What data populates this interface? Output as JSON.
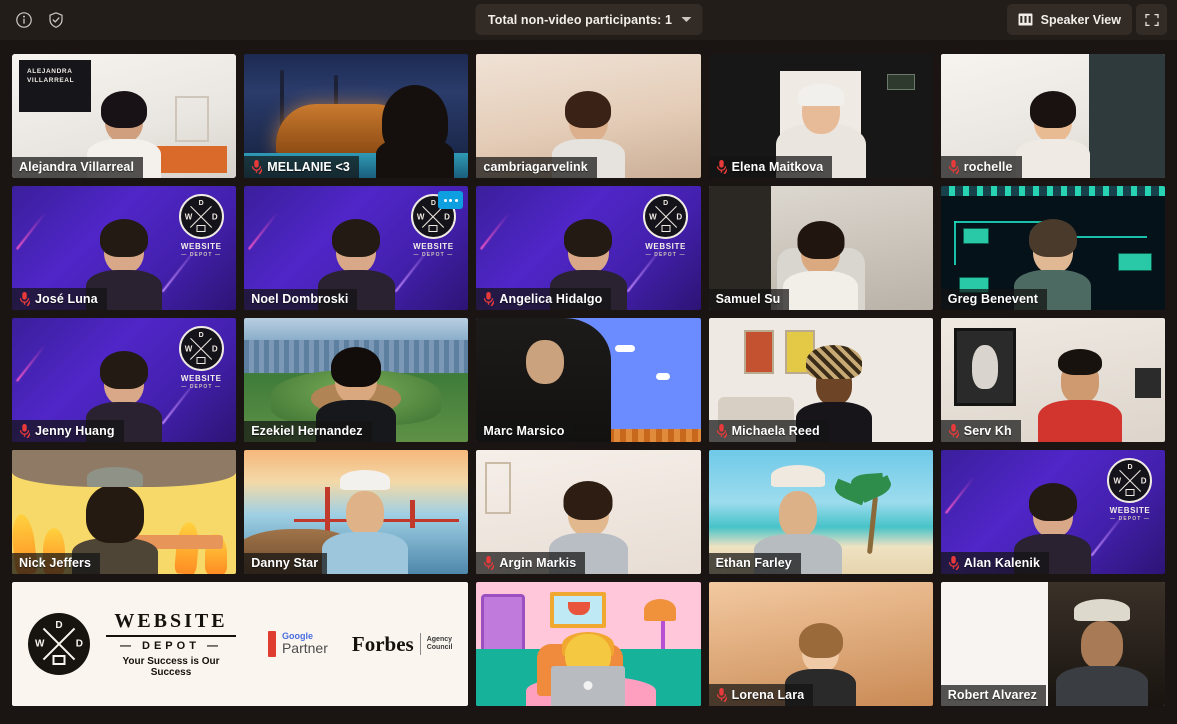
{
  "topbar": {
    "info_icon": "info-icon",
    "shield_icon": "shield-check-icon",
    "nonvideo_label": "Total non-video participants: 1",
    "speaker_view_label": "Speaker View",
    "grid_icon": "grid-view-icon",
    "fullscreen_icon": "fullscreen-icon"
  },
  "meeting": {
    "view_mode": "Gallery View",
    "accent_active_border": "#f5f0a0",
    "muted_icon_color": "#e83a3a",
    "more_button_color": "#0e9fe0",
    "nameplate_bg": "rgba(20,20,20,0.72)"
  },
  "participants": [
    {
      "name": "Alejandra Villarreal",
      "muted": false,
      "active_speaker": true,
      "more": false,
      "scene": "villarreal"
    },
    {
      "name": "MELLANIE <3",
      "muted": true,
      "active_speaker": false,
      "more": false,
      "scene": "pool"
    },
    {
      "name": "cambriagarvelink",
      "muted": false,
      "active_speaker": false,
      "more": false,
      "scene": "warm-room"
    },
    {
      "name": "Elena Maitkova",
      "muted": true,
      "active_speaker": false,
      "more": false,
      "scene": "dark-room"
    },
    {
      "name": "rochelle",
      "muted": true,
      "active_speaker": false,
      "more": false,
      "scene": "white-room"
    },
    {
      "name": "José Luna",
      "muted": true,
      "active_speaker": false,
      "more": false,
      "scene": "wd"
    },
    {
      "name": "Noel Dombroski",
      "muted": false,
      "active_speaker": false,
      "more": true,
      "scene": "wd"
    },
    {
      "name": "Angelica Hidalgo",
      "muted": true,
      "active_speaker": false,
      "more": false,
      "scene": "wd"
    },
    {
      "name": "Samuel Su",
      "muted": false,
      "active_speaker": false,
      "more": false,
      "scene": "office"
    },
    {
      "name": "Greg Benevent",
      "muted": false,
      "active_speaker": false,
      "more": false,
      "scene": "circuit"
    },
    {
      "name": "Jenny Huang",
      "muted": true,
      "active_speaker": false,
      "more": false,
      "scene": "wd"
    },
    {
      "name": "Ezekiel Hernandez",
      "muted": false,
      "active_speaker": false,
      "more": false,
      "scene": "stadium"
    },
    {
      "name": "Marc Marsico",
      "muted": false,
      "active_speaker": false,
      "more": false,
      "scene": "mario"
    },
    {
      "name": "Michaela Reed",
      "muted": true,
      "active_speaker": false,
      "more": false,
      "scene": "posters"
    },
    {
      "name": "Serv Kh",
      "muted": true,
      "active_speaker": false,
      "more": false,
      "scene": "gallery"
    },
    {
      "name": "Nick Jeffers",
      "muted": false,
      "active_speaker": false,
      "more": false,
      "scene": "fire"
    },
    {
      "name": "Danny Star",
      "muted": false,
      "active_speaker": false,
      "more": false,
      "scene": "ggb"
    },
    {
      "name": "Argin Markis",
      "muted": true,
      "active_speaker": false,
      "more": false,
      "scene": "pink-room"
    },
    {
      "name": "Ethan Farley",
      "muted": false,
      "active_speaker": false,
      "more": false,
      "scene": "beach"
    },
    {
      "name": "Alan Kalenik",
      "muted": true,
      "active_speaker": false,
      "more": false,
      "scene": "wd"
    },
    {
      "name": "",
      "muted": false,
      "active_speaker": false,
      "more": false,
      "scene": "banner",
      "wide": true
    },
    {
      "name": "",
      "muted": false,
      "active_speaker": false,
      "more": false,
      "scene": "cartoon"
    },
    {
      "name": "Lorena Lara",
      "muted": true,
      "active_speaker": false,
      "more": false,
      "scene": "warm-room2"
    },
    {
      "name": "Robert Alvarez",
      "muted": false,
      "active_speaker": false,
      "more": false,
      "scene": "split-dark"
    }
  ],
  "banner": {
    "brand_line1": "WEBSITE",
    "brand_line2": "— DEPOT —",
    "tagline": "Your Success is Our Success",
    "google_partner_line1": "Google",
    "google_partner_line2": "Partner",
    "forbes": "Forbes",
    "forbes_sub1": "Agency",
    "forbes_sub2": "Council",
    "logo_letters": {
      "top": "D",
      "left": "W",
      "right": "D"
    },
    "bg": "#fbf5f0"
  },
  "wd_background": {
    "brand": "WEBSITE",
    "sub": "— DEPOT —",
    "letters": {
      "top": "D",
      "left": "W",
      "right": "D"
    }
  },
  "villarreal_card": {
    "line1": "ALEJANDRA",
    "line2": "VILLARREAL"
  }
}
